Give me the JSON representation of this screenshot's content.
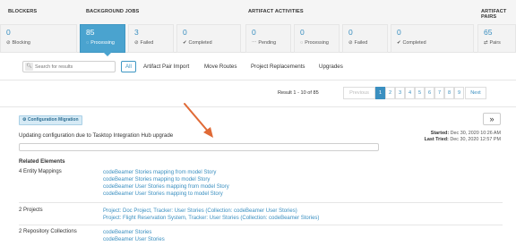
{
  "groups": {
    "blockers": "BLOCKERS",
    "background_jobs": "BACKGROUND JOBS",
    "artifact_activities": "ARTIFACT ACTIVITIES",
    "artifact_pairs": "ARTIFACT PAIRS"
  },
  "tiles": [
    {
      "num": "0",
      "label": "Blocking",
      "icon": "⊘"
    },
    {
      "num": "85",
      "label": "Processing",
      "icon": "◌"
    },
    {
      "num": "3",
      "label": "Failed",
      "icon": "⊘"
    },
    {
      "num": "0",
      "label": "Completed",
      "icon": "✔"
    },
    {
      "num": "0",
      "label": "Pending",
      "icon": "⋯"
    },
    {
      "num": "0",
      "label": "Processing",
      "icon": "◌"
    },
    {
      "num": "0",
      "label": "Failed",
      "icon": "⊘"
    },
    {
      "num": "0",
      "label": "Completed",
      "icon": "✔"
    },
    {
      "num": "65",
      "label": "Pairs",
      "icon": "⇄"
    }
  ],
  "filters": {
    "search_placeholder": "Search for results",
    "all": "All",
    "items": [
      "Artifact Pair Import",
      "Move Routes",
      "Project Replacements",
      "Upgrades"
    ]
  },
  "pagination": {
    "result": "Result 1 - 10 of 85",
    "previous": "Previous",
    "pages": [
      "1",
      "2",
      "3",
      "4",
      "5",
      "6",
      "7",
      "8",
      "9"
    ],
    "next": "Next"
  },
  "job": {
    "badge": "Configuration Migration",
    "message": "Updating configuration due to Tasktop Integration Hub upgrade",
    "started_label": "Started:",
    "started_value": "Dec 30, 2020 10:26 AM",
    "last_tried_label": "Last Tried:",
    "last_tried_value": "Dec 30, 2020 12:57 PM",
    "expand_icon": "»"
  },
  "related": {
    "heading": "Related Elements",
    "groups": [
      {
        "label": "4 Entity Mappings",
        "links": [
          "codeBeamer Stories mapping from model Story",
          "codeBeamer Stories mapping to model Story",
          "codeBeamer User Stories mapping from model Story",
          "codeBeamer User Stories mapping to model Story"
        ]
      },
      {
        "label": "2 Projects",
        "links": [
          "Project: Doc Project, Tracker: User Stories (Collection: codeBeamer User Stories)",
          "Project: Flight Reservation System, Tracker: User Stories (Collection: codeBeamer Stories)"
        ]
      },
      {
        "label": "2 Repository Collections",
        "links": [
          "codeBeamer Stories",
          "codeBeamer User Stories"
        ]
      }
    ]
  },
  "colors": {
    "accent": "#4aa3cf",
    "link": "#3a8fc0",
    "arrow": "#e06a36"
  }
}
